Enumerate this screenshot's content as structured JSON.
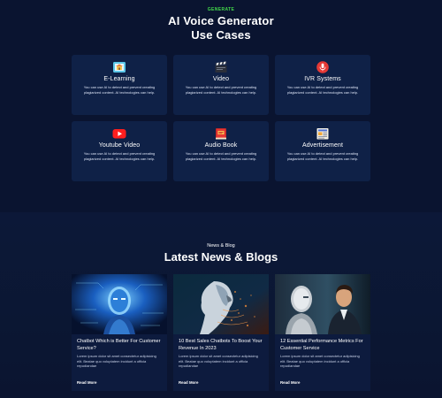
{
  "use_cases": {
    "eyebrow": "GENERATE",
    "title_line1": "AI Voice Generator",
    "title_line2": "Use Cases",
    "cards": [
      {
        "title": "E-Learning",
        "desc": "You can use AI to detect and prevent creating plagiarized content. AI technologies can help.",
        "icon": "school-building-icon"
      },
      {
        "title": "Video",
        "desc": "You can use AI to detect and prevent creating plagiarized content. AI technologies can help.",
        "icon": "clapperboard-icon"
      },
      {
        "title": "IVR Systems",
        "desc": "You can use AI to detect and prevent creating plagiarized content. AI technologies can help.",
        "icon": "microphone-icon"
      },
      {
        "title": "Youtube Video",
        "desc": "You can use AI to detect and prevent creating plagiarized content. AI technologies can help.",
        "icon": "youtube-play-icon"
      },
      {
        "title": "Audio Book",
        "desc": "You can use AI to detect and prevent creating plagiarized content. AI technologies can help.",
        "icon": "book-icon"
      },
      {
        "title": "Advertisement",
        "desc": "You can use AI to detect and prevent creating plagiarized content. AI technologies can help.",
        "icon": "newspaper-icon"
      }
    ]
  },
  "blog_section": {
    "eyebrow": "News & Blog",
    "title": "Latest News & Blogs",
    "posts": [
      {
        "title": "Chatbot Which is Better For Customer Service?",
        "excerpt": "Lorem ipsum dolor sit amet consectetur adipisicing elit. Beatae quo voluptatem incidunt a officia repudiandae",
        "read_more": "Read More",
        "image": "blue-robot-circuit-image"
      },
      {
        "title": "10 Best Sales Chatbots To Boost Your Revenue In 2023",
        "excerpt": "Lorem ipsum dolor sit amet consectetur adipisicing elit. Beatae quo voluptatem incidunt a officia repudiandae",
        "read_more": "Read More",
        "image": "ai-face-profile-image"
      },
      {
        "title": "12 Essential Performance Metrics For Customer Service",
        "excerpt": "Lorem ipsum dolor sit amet consectetur adipisicing elit. Beatae quo voluptatem incidunt a officia repudiandae",
        "read_more": "Read More",
        "image": "man-facing-robot-image"
      }
    ]
  },
  "colors": {
    "background": "#0a1430",
    "card": "#0f2147",
    "accent_green": "#43d94b"
  }
}
